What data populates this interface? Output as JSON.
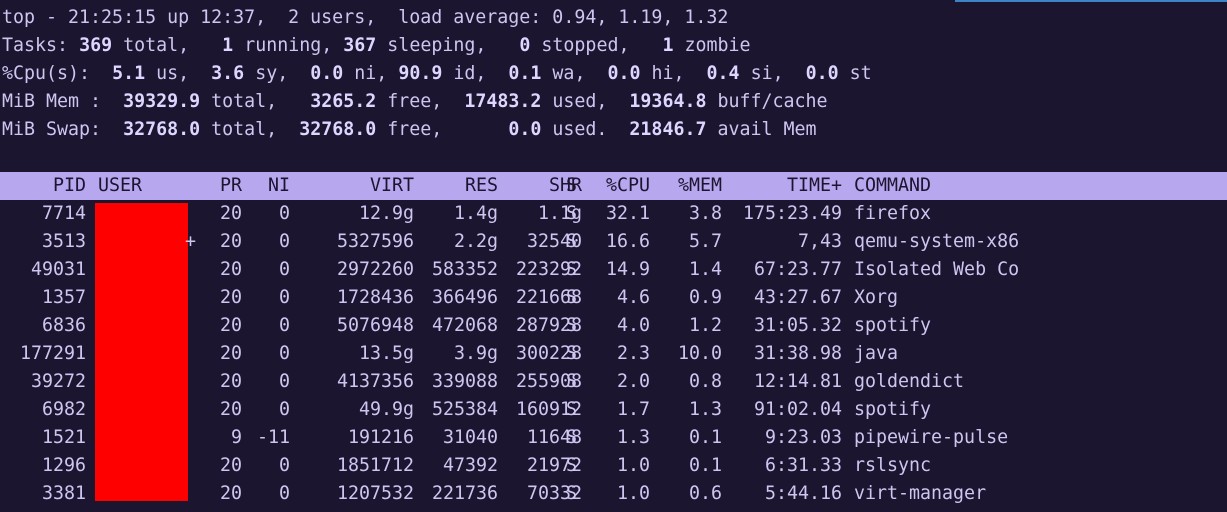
{
  "summary": {
    "line1": "top - 21:25:15 up 12:37,  2 users,  load average: 0.94, 1.19, 1.32",
    "tasks": {
      "label": "Tasks:",
      "total": "369",
      "total_lbl": " total,",
      "running": "1",
      "running_lbl": " running,",
      "sleeping": "367",
      "sleeping_lbl": " sleeping,",
      "stopped": "0",
      "stopped_lbl": " stopped,",
      "zombie": "1",
      "zombie_lbl": " zombie"
    },
    "cpu": {
      "label": "%Cpu(s):",
      "us": "5.1",
      "us_lbl": " us,",
      "sy": "3.6",
      "sy_lbl": " sy,",
      "ni": "0.0",
      "ni_lbl": " ni,",
      "id": "90.9",
      "id_lbl": " id,",
      "wa": "0.1",
      "wa_lbl": " wa,",
      "hi": "0.0",
      "hi_lbl": " hi,",
      "si": "0.4",
      "si_lbl": " si,",
      "st": "0.0",
      "st_lbl": " st"
    },
    "mem": {
      "label": "MiB Mem :",
      "total": "39329.9",
      "total_lbl": " total,",
      "free": "3265.2",
      "free_lbl": " free,",
      "used": "17483.2",
      "used_lbl": " used,",
      "cache": "19364.8",
      "cache_lbl": " buff/cache"
    },
    "swap": {
      "label": "MiB Swap:",
      "total": "32768.0",
      "total_lbl": " total,",
      "free": "32768.0",
      "free_lbl": " free,",
      "used": "0.0",
      "used_lbl": " used.",
      "avail": "21846.7",
      "avail_lbl": " avail Mem"
    }
  },
  "columns": [
    "PID",
    "USER",
    "PR",
    "NI",
    "VIRT",
    "RES",
    "SHR",
    "S",
    "%CPU",
    "%MEM",
    "TIME+",
    "COMMAND"
  ],
  "processes": [
    {
      "pid": "7714",
      "user": "",
      "pr": "20",
      "ni": "0",
      "virt": "12.9g",
      "res": "1.4g",
      "shr": "1.1g",
      "s": "S",
      "cpu": "32.1",
      "mem": "3.8",
      "time": "175:23.49",
      "cmd": "firefox"
    },
    {
      "pid": "3513",
      "user": "",
      "pr": "20",
      "ni": "0",
      "virt": "5327596",
      "res": "2.2g",
      "shr": "32540",
      "s": "S",
      "cpu": "16.6",
      "mem": "5.7",
      "time": "7,43",
      "cmd": "qemu-system-x86"
    },
    {
      "pid": "49031",
      "user": "",
      "pr": "20",
      "ni": "0",
      "virt": "2972260",
      "res": "583352",
      "shr": "223292",
      "s": "S",
      "cpu": "14.9",
      "mem": "1.4",
      "time": "67:23.77",
      "cmd": "Isolated Web Co"
    },
    {
      "pid": "1357",
      "user": "",
      "pr": "20",
      "ni": "0",
      "virt": "1728436",
      "res": "366496",
      "shr": "221668",
      "s": "S",
      "cpu": "4.6",
      "mem": "0.9",
      "time": "43:27.67",
      "cmd": "Xorg"
    },
    {
      "pid": "6836",
      "user": "",
      "pr": "20",
      "ni": "0",
      "virt": "5076948",
      "res": "472068",
      "shr": "287928",
      "s": "S",
      "cpu": "4.0",
      "mem": "1.2",
      "time": "31:05.32",
      "cmd": "spotify"
    },
    {
      "pid": "177291",
      "user": "",
      "pr": "20",
      "ni": "0",
      "virt": "13.5g",
      "res": "3.9g",
      "shr": "300228",
      "s": "S",
      "cpu": "2.3",
      "mem": "10.0",
      "time": "31:38.98",
      "cmd": "java"
    },
    {
      "pid": "39272",
      "user": "",
      "pr": "20",
      "ni": "0",
      "virt": "4137356",
      "res": "339088",
      "shr": "255908",
      "s": "S",
      "cpu": "2.0",
      "mem": "0.8",
      "time": "12:14.81",
      "cmd": "goldendict"
    },
    {
      "pid": "6982",
      "user": "",
      "pr": "20",
      "ni": "0",
      "virt": "49.9g",
      "res": "525384",
      "shr": "160912",
      "s": "S",
      "cpu": "1.7",
      "mem": "1.3",
      "time": "91:02.04",
      "cmd": "spotify"
    },
    {
      "pid": "1521",
      "user": "",
      "pr": "9",
      "ni": "-11",
      "virt": "191216",
      "res": "31040",
      "shr": "11648",
      "s": "S",
      "cpu": "1.3",
      "mem": "0.1",
      "time": "9:23.03",
      "cmd": "pipewire-pulse"
    },
    {
      "pid": "1296",
      "user": "",
      "pr": "20",
      "ni": "0",
      "virt": "1851712",
      "res": "47392",
      "shr": "21972",
      "s": "S",
      "cpu": "1.0",
      "mem": "0.1",
      "time": "6:31.33",
      "cmd": "rslsync"
    },
    {
      "pid": "3381",
      "user": "",
      "pr": "20",
      "ni": "0",
      "virt": "1207532",
      "res": "221736",
      "shr": "70332",
      "s": "S",
      "cpu": "1.0",
      "mem": "0.6",
      "time": "5:44.16",
      "cmd": "virt-manager"
    }
  ],
  "colors": {
    "background": "#1b1530",
    "text": "#cfc6f0",
    "header_bar": "#b6a7ee",
    "redaction": "#ff0000"
  }
}
